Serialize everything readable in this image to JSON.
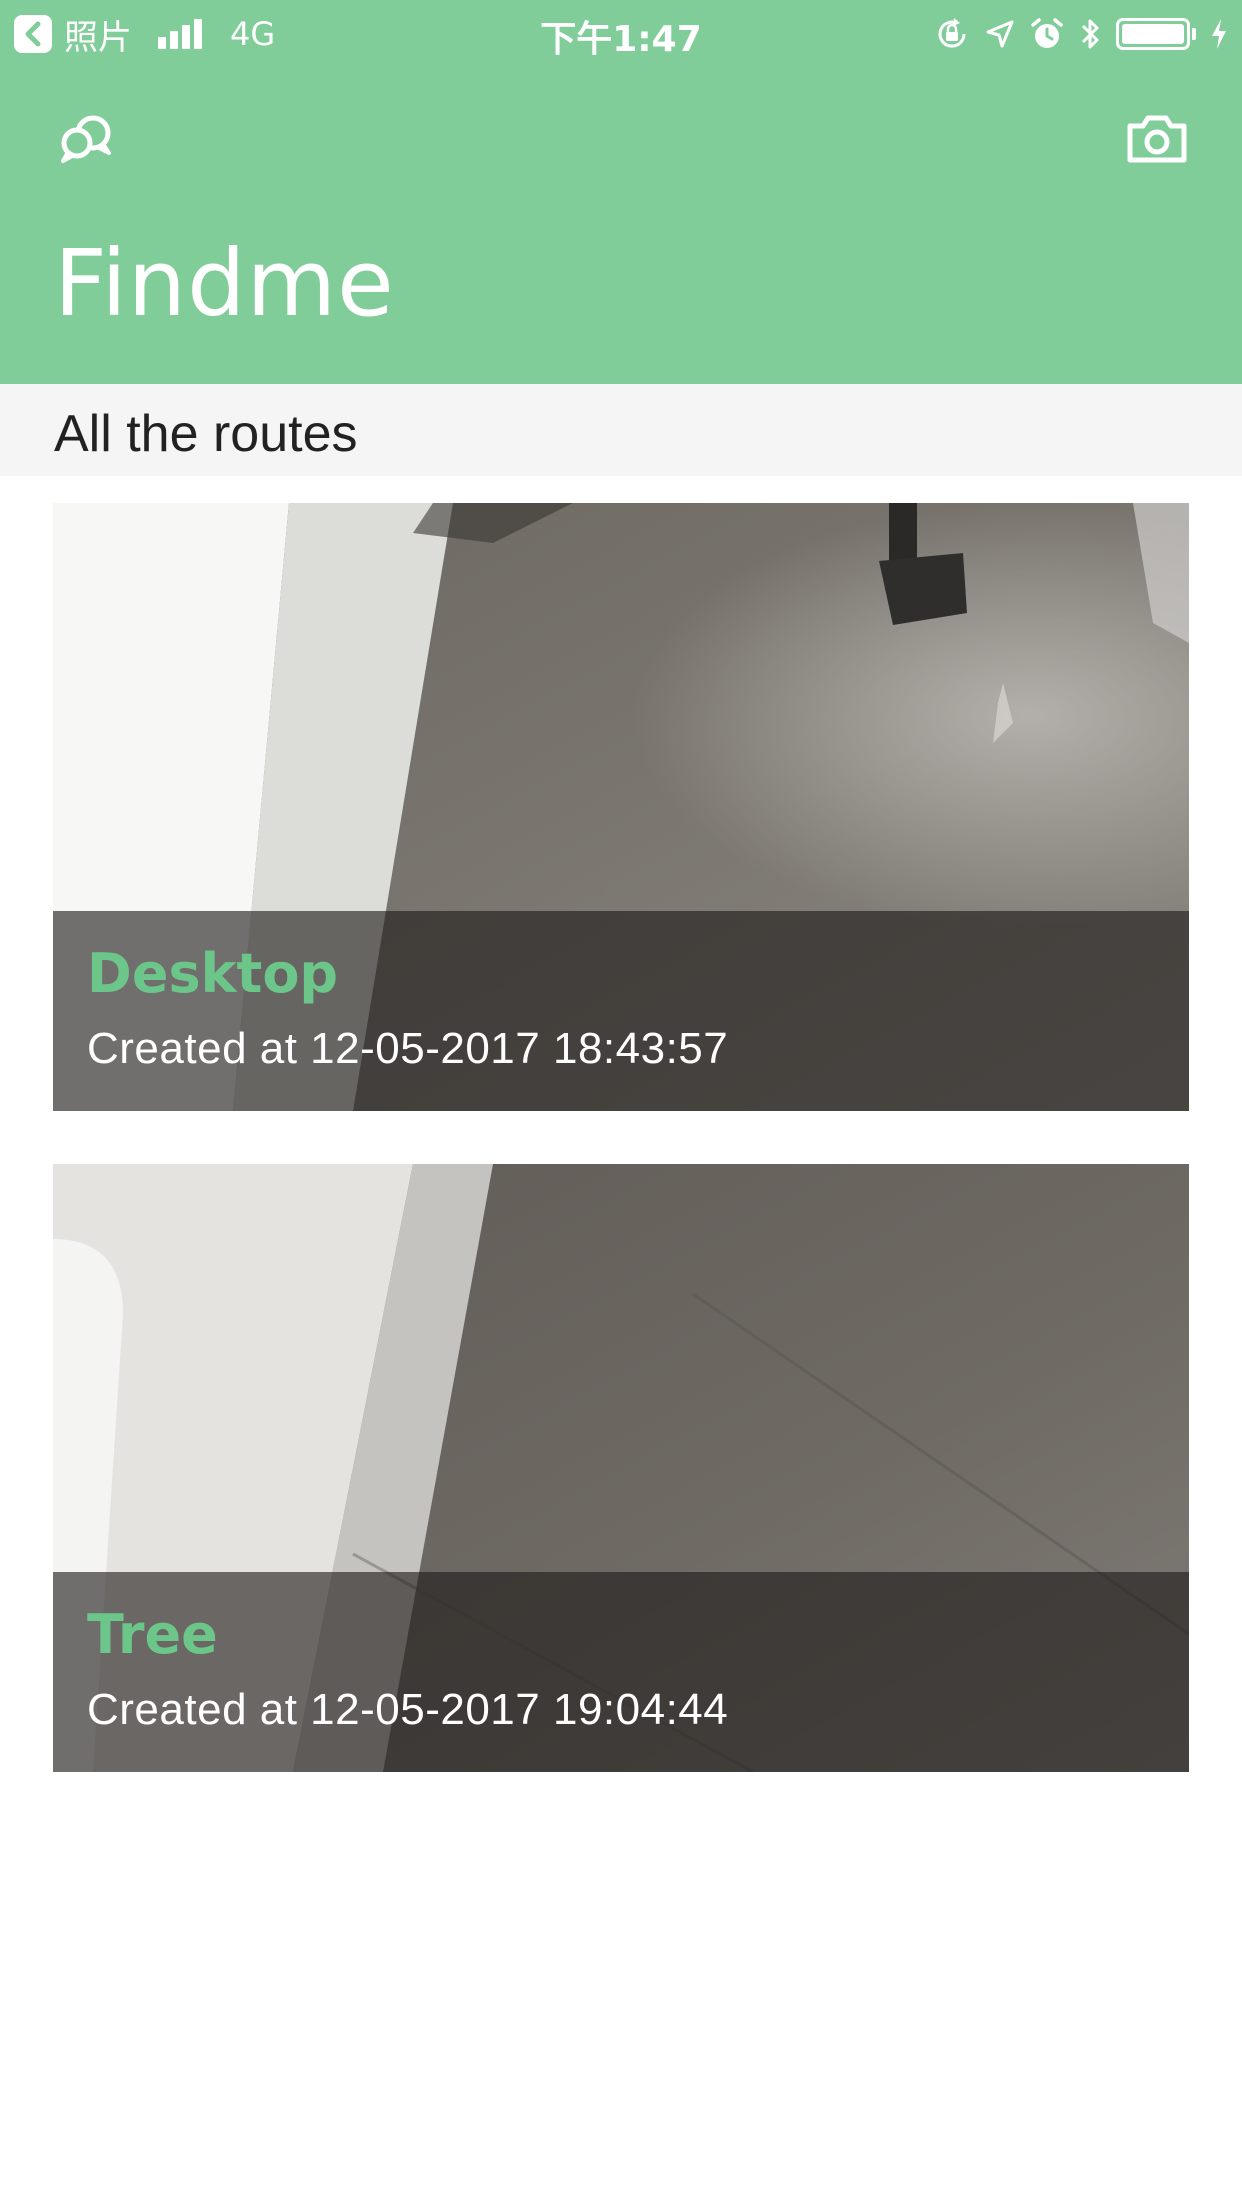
{
  "status_bar": {
    "back_app": "照片",
    "carrier": "4G",
    "time": "下午1:47",
    "icons": [
      "orientation-lock-icon",
      "location-arrow-icon",
      "alarm-icon",
      "bluetooth-icon",
      "battery-icon",
      "charging-icon"
    ]
  },
  "app_bar": {
    "title": "Findme",
    "left_icon": "chat-bubbles-icon",
    "right_icon": "camera-icon"
  },
  "section": {
    "title": "All the routes"
  },
  "routes": [
    {
      "name": "Desktop",
      "created": "Created at 12-05-2017 18:43:57"
    },
    {
      "name": "Tree",
      "created": "Created at 12-05-2017 19:04:44"
    }
  ],
  "colors": {
    "brand_green": "#81cd9a",
    "route_name_green": "#6cc68a",
    "section_background": "#f5f5f5"
  }
}
